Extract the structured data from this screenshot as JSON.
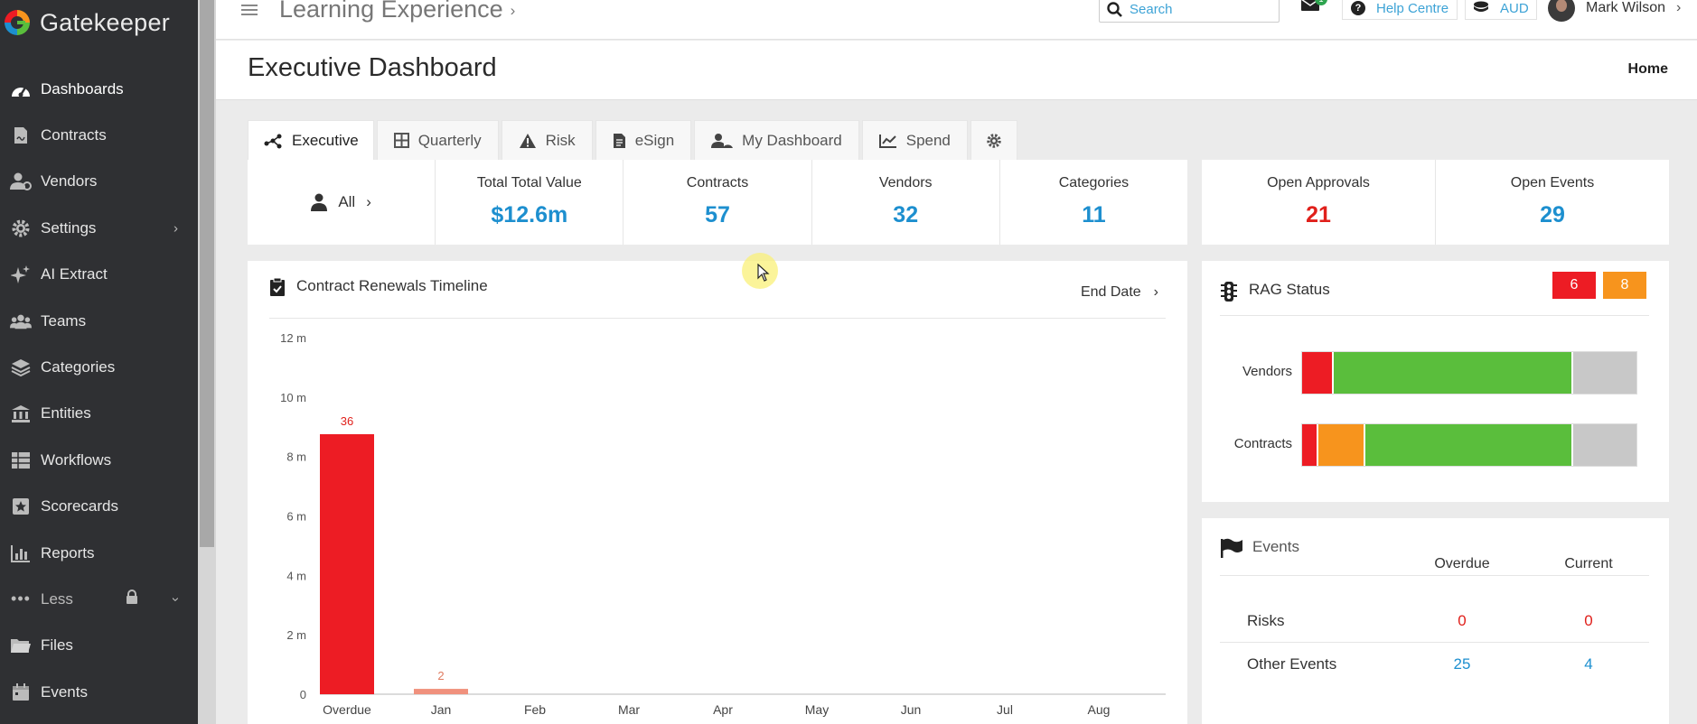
{
  "brand": {
    "name": "Gatekeeper"
  },
  "sidebar": {
    "items": [
      {
        "label": "Dashboards",
        "icon": "gauge-icon",
        "active": true
      },
      {
        "label": "Contracts",
        "icon": "contract-icon"
      },
      {
        "label": "Vendors",
        "icon": "vendors-icon"
      },
      {
        "label": "Settings",
        "icon": "gear-icon",
        "has_submenu": true
      },
      {
        "label": "AI Extract",
        "icon": "sparkle-icon"
      },
      {
        "label": "Teams",
        "icon": "teams-icon"
      },
      {
        "label": "Categories",
        "icon": "layers-icon"
      },
      {
        "label": "Entities",
        "icon": "bank-icon"
      },
      {
        "label": "Workflows",
        "icon": "table-icon"
      },
      {
        "label": "Scorecards",
        "icon": "star-card-icon"
      },
      {
        "label": "Reports",
        "icon": "bar-chart-icon"
      },
      {
        "label": "Less",
        "icon": "ellipsis-icon",
        "locked": true,
        "expandable": true
      },
      {
        "label": "Files",
        "icon": "folder-icon"
      },
      {
        "label": "Events",
        "icon": "calendar-icon"
      }
    ]
  },
  "topbar": {
    "app_title": "Learning Experience",
    "search_placeholder": "Search",
    "mail_count": "1",
    "help_label": "Help Centre",
    "currency": "AUD",
    "user_name": "Mark Wilson"
  },
  "page": {
    "title": "Executive Dashboard",
    "breadcrumb": "Home"
  },
  "tabs": [
    {
      "label": "Executive",
      "icon": "nodes-icon",
      "active": true
    },
    {
      "label": "Quarterly",
      "icon": "grid-icon"
    },
    {
      "label": "Risk",
      "icon": "warning-icon"
    },
    {
      "label": "eSign",
      "icon": "document-icon"
    },
    {
      "label": "My Dashboard",
      "icon": "user-gauge-icon"
    },
    {
      "label": "Spend",
      "icon": "line-chart-icon"
    }
  ],
  "kpis": {
    "filter_label": "All",
    "items": [
      {
        "label": "Total Total Value",
        "value": "$12.6m"
      },
      {
        "label": "Contracts",
        "value": "57"
      },
      {
        "label": "Vendors",
        "value": "32"
      },
      {
        "label": "Categories",
        "value": "11"
      }
    ],
    "right": [
      {
        "label": "Open Approvals",
        "value": "21",
        "color": "#e0201b"
      },
      {
        "label": "Open Events",
        "value": "29",
        "color": "#1d8fcf"
      }
    ]
  },
  "chart_panel": {
    "title": "Contract Renewals Timeline",
    "sort_label": "End Date"
  },
  "chart_data": {
    "type": "bar",
    "categories": [
      "Overdue",
      "Jan",
      "Feb",
      "Mar",
      "Apr",
      "May",
      "Jun",
      "Jul",
      "Aug"
    ],
    "values": [
      8.75,
      0.18,
      0,
      0,
      0,
      0,
      0,
      0,
      0
    ],
    "data_labels": [
      "36",
      "2",
      "",
      "",
      "",
      "",
      "",
      "",
      ""
    ],
    "bar_colors": [
      "#ed1c24",
      "#f0917d",
      "#ed1c24",
      "#ed1c24",
      "#ed1c24",
      "#ed1c24",
      "#ed1c24",
      "#ed1c24",
      "#ed1c24"
    ],
    "y_ticks": [
      "0",
      "2 m",
      "4 m",
      "6 m",
      "8 m",
      "10 m",
      "12 m"
    ],
    "ylim": [
      0,
      12
    ],
    "title": "",
    "xlabel": "",
    "ylabel": "",
    "grid": false
  },
  "rag": {
    "title": "RAG Status",
    "badge_red": "6",
    "badge_amber": "8",
    "rows": [
      {
        "label": "Vendors",
        "red": 0.08,
        "amber": 0.0,
        "green": 0.61,
        "grey": 0.16
      },
      {
        "label": "Contracts",
        "red": 0.04,
        "amber": 0.12,
        "green": 0.52,
        "grey": 0.16
      }
    ],
    "colors": {
      "red": "#ed1c24",
      "amber": "#f7941d",
      "green": "#5abe3c",
      "grey": "#c8c8c8"
    }
  },
  "events": {
    "title": "Events",
    "col_overdue": "Overdue",
    "col_current": "Current",
    "rows": [
      {
        "name": "Risks",
        "overdue": "0",
        "current": "0",
        "color": "#e0201b"
      },
      {
        "name": "Other Events",
        "overdue": "25",
        "current": "4",
        "color": "#1d8fcf"
      }
    ]
  }
}
